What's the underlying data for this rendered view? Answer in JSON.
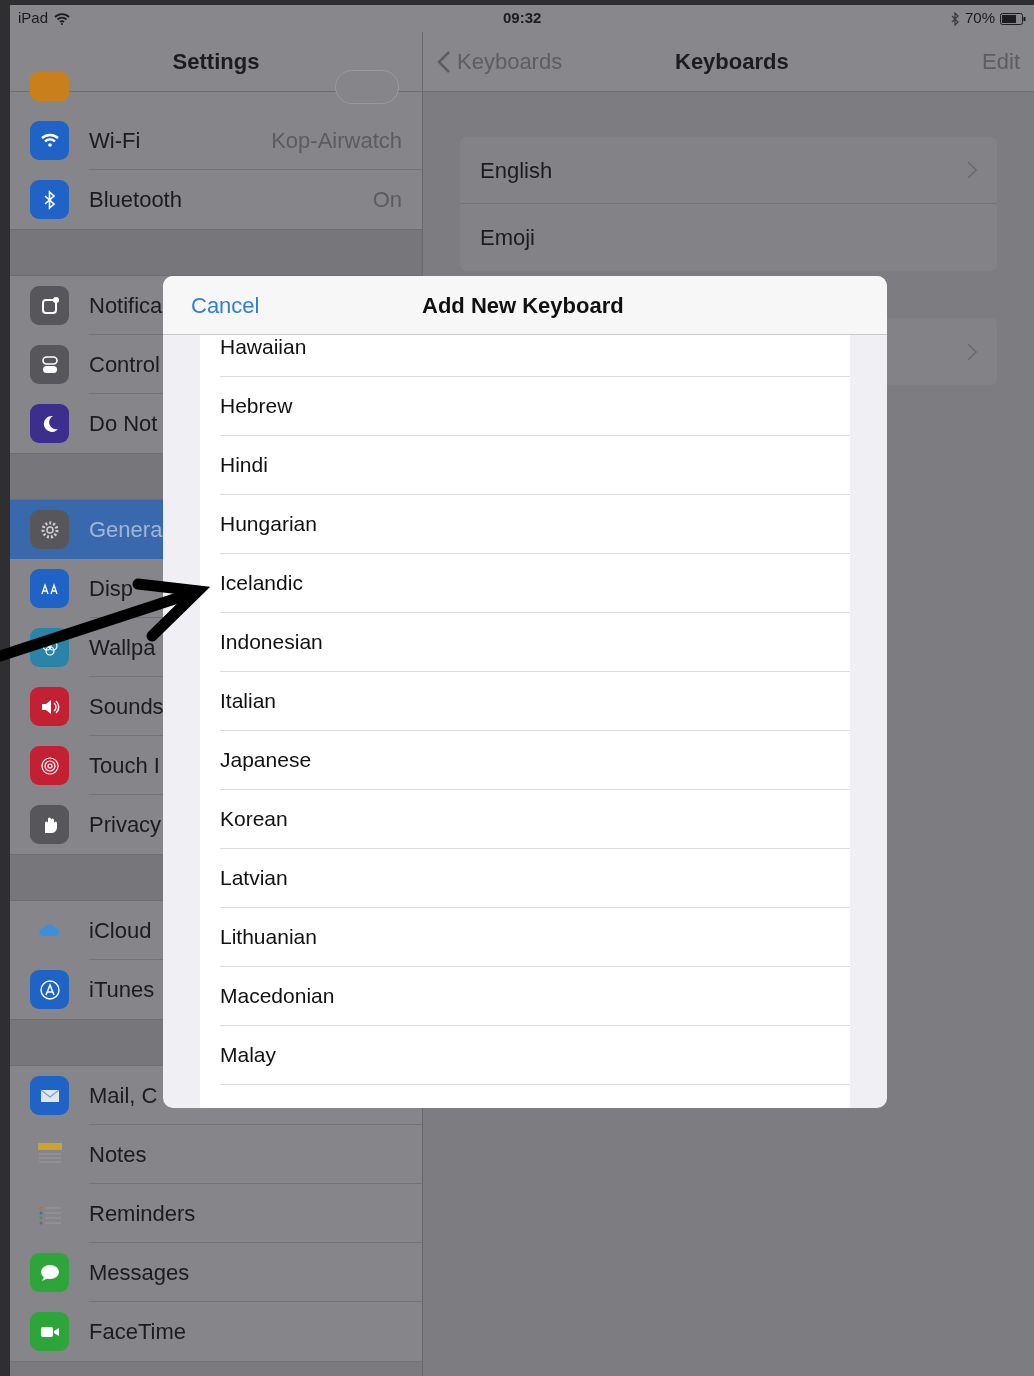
{
  "status_bar": {
    "device": "iPad",
    "time": "09:32",
    "battery": "70%"
  },
  "sidebar": {
    "title": "Settings",
    "toggle": {
      "on": false
    },
    "groups": [
      {
        "items": [
          {
            "label": "Wi-Fi",
            "value": "Kop-Airwatch",
            "color": "#1f63c7",
            "selected": false
          },
          {
            "label": "Bluetooth",
            "value": "On",
            "color": "#1f63c7",
            "selected": false
          }
        ]
      },
      {
        "items": [
          {
            "label": "Notifica",
            "color": "#57575b",
            "selected": false
          },
          {
            "label": "Control",
            "color": "#57575b",
            "selected": false
          },
          {
            "label": "Do Not",
            "color": "#3b2e8c",
            "selected": false
          }
        ]
      },
      {
        "items": [
          {
            "label": "Genera",
            "color": "#57575b",
            "selected": true
          },
          {
            "label": "Disp",
            "color": "#1f63c7",
            "selected": false
          },
          {
            "label": "Wallpa",
            "color": "#2a84a8",
            "selected": false
          },
          {
            "label": "Sounds",
            "color": "#c42033",
            "selected": false
          },
          {
            "label": "Touch I",
            "color": "#c42033",
            "selected": false
          },
          {
            "label": "Privacy",
            "color": "#57575b",
            "selected": false
          }
        ]
      },
      {
        "items": [
          {
            "label": "iCloud",
            "color": "#85858a",
            "selected": false
          },
          {
            "label": "iTunes",
            "color": "#1f63c7",
            "selected": false
          }
        ]
      },
      {
        "items": [
          {
            "label": "Mail, C",
            "color": "#1f63c7",
            "selected": false
          },
          {
            "label": "Notes",
            "color": "#85858a",
            "selected": false
          },
          {
            "label": "Reminders",
            "color": "#85858a",
            "selected": false
          },
          {
            "label": "Messages",
            "color": "#2da53a",
            "selected": false
          },
          {
            "label": "FaceTime",
            "color": "#2da53a",
            "selected": false
          }
        ]
      }
    ]
  },
  "detail": {
    "back": "Keyboards",
    "title": "Keyboards",
    "action": "Edit",
    "keyboards": [
      {
        "label": "English",
        "chevron": true
      },
      {
        "label": "Emoji",
        "chevron": false
      }
    ]
  },
  "dialog": {
    "cancel": "Cancel",
    "title": "Add New Keyboard",
    "languages": [
      "Hawaiian",
      "Hebrew",
      "Hindi",
      "Hungarian",
      "Icelandic",
      "Indonesian",
      "Italian",
      "Japanese",
      "Korean",
      "Latvian",
      "Lithuanian",
      "Macedonian",
      "Malay"
    ]
  }
}
